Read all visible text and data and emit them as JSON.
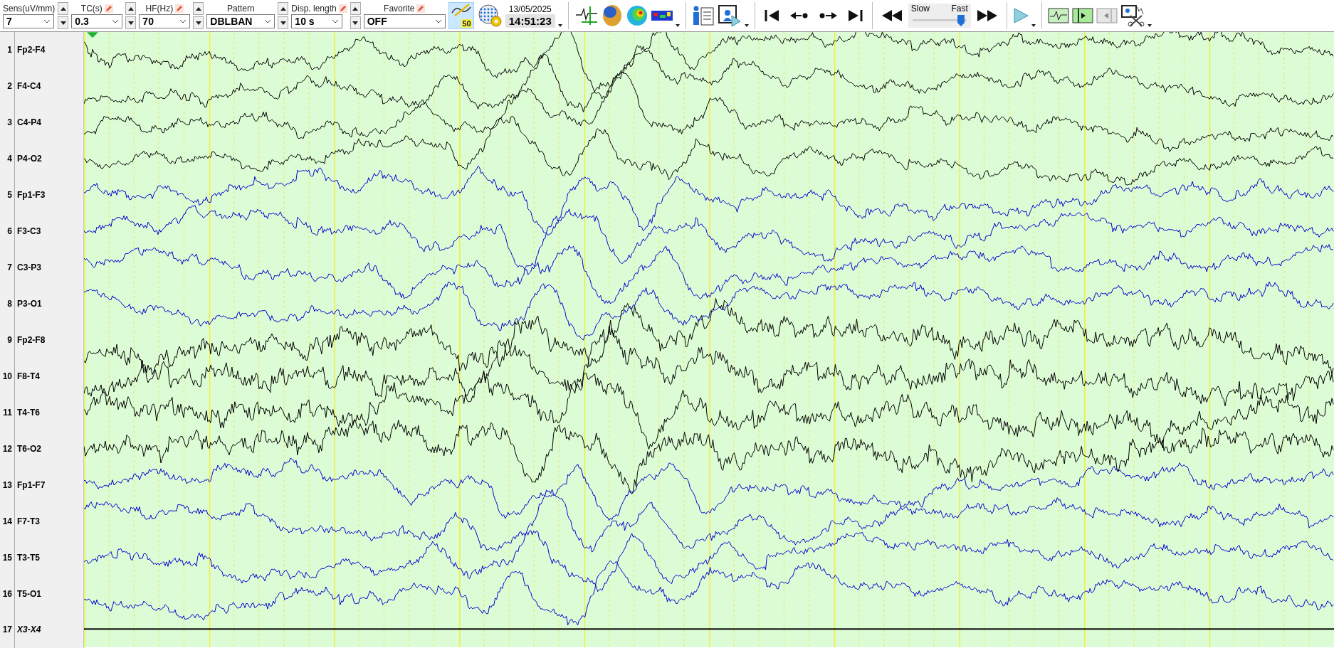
{
  "toolbar": {
    "fields": [
      {
        "label": "Sens(uV/mm)",
        "value": "7",
        "kind": "spin"
      },
      {
        "label": "TC(s)",
        "value": "0.3",
        "kind": "spin-edit"
      },
      {
        "label": "HF(Hz)",
        "value": "70",
        "kind": "spin-edit"
      },
      {
        "label": "Pattern",
        "value": "DBLBAN",
        "kind": "spin"
      },
      {
        "label": "Disp. length",
        "value": "10 s",
        "kind": "spin-edit"
      },
      {
        "label": "Favorite",
        "value": "OFF",
        "kind": "edit"
      }
    ],
    "auto_scale_button": {
      "badge": "50",
      "active": true
    },
    "recording": {
      "date": "13/05/2025",
      "time": "14:51:23"
    },
    "speed": {
      "slow_label": "Slow",
      "fast_label": "Fast",
      "level": 0.88
    }
  },
  "channels": [
    {
      "number": "1",
      "label": "Fp2-F4",
      "color": "#000000",
      "kind": "trace"
    },
    {
      "number": "2",
      "label": "F4-C4",
      "color": "#000000",
      "kind": "trace"
    },
    {
      "number": "3",
      "label": "C4-P4",
      "color": "#000000",
      "kind": "trace"
    },
    {
      "number": "4",
      "label": "P4-O2",
      "color": "#000000",
      "kind": "trace"
    },
    {
      "number": "5",
      "label": "Fp1-F3",
      "color": "#0000cc",
      "kind": "trace"
    },
    {
      "number": "6",
      "label": "F3-C3",
      "color": "#0000cc",
      "kind": "trace"
    },
    {
      "number": "7",
      "label": "C3-P3",
      "color": "#0000cc",
      "kind": "trace"
    },
    {
      "number": "8",
      "label": "P3-O1",
      "color": "#0000cc",
      "kind": "trace"
    },
    {
      "number": "9",
      "label": "Fp2-F8",
      "color": "#000000",
      "kind": "trace"
    },
    {
      "number": "10",
      "label": "F8-T4",
      "color": "#000000",
      "kind": "trace"
    },
    {
      "number": "11",
      "label": "T4-T6",
      "color": "#000000",
      "kind": "trace"
    },
    {
      "number": "12",
      "label": "T6-O2",
      "color": "#000000",
      "kind": "trace"
    },
    {
      "number": "13",
      "label": "Fp1-F7",
      "color": "#0000cc",
      "kind": "trace"
    },
    {
      "number": "14",
      "label": "F7-T3",
      "color": "#0000cc",
      "kind": "trace"
    },
    {
      "number": "15",
      "label": "T3-T5",
      "color": "#0000cc",
      "kind": "trace"
    },
    {
      "number": "16",
      "label": "T5-O1",
      "color": "#0000cc",
      "kind": "trace"
    },
    {
      "number": "17",
      "label": "X3-X4",
      "color": "#000000",
      "kind": "flat"
    }
  ]
}
